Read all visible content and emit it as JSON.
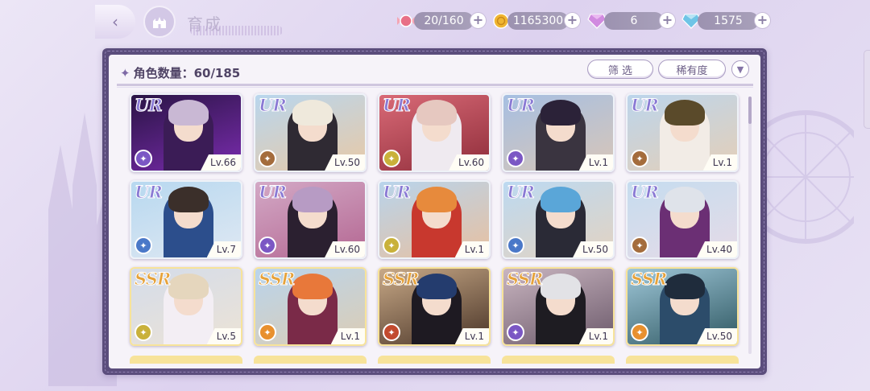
{
  "header": {
    "title": "育成",
    "resources": [
      {
        "name": "stamina",
        "icon": "candy-icon",
        "value": "20/160",
        "color": "#e86f86"
      },
      {
        "name": "gold",
        "icon": "coin-icon",
        "value": "1165300",
        "color": "#f0b532"
      },
      {
        "name": "pink-gem",
        "icon": "pink-diamond-icon",
        "value": "6",
        "color": "#d18ae0"
      },
      {
        "name": "blue-gem",
        "icon": "blue-diamond-icon",
        "value": "1575",
        "color": "#6ec4e6"
      }
    ]
  },
  "panel": {
    "count_label": "角色数量：60/185",
    "filter_label": "筛 选",
    "sort_label": "稀有度",
    "sort_toggle_icon": "chevron-down-icon"
  },
  "cards": [
    {
      "rarity": "UR",
      "level": "Lv.66",
      "element_color": "#7b57c4",
      "scene": [
        "#2a1445",
        "#7a2cae"
      ],
      "hair": "#c9b8d4",
      "outfit": "#3b1c56"
    },
    {
      "rarity": "UR",
      "level": "Lv.50",
      "element_color": "#a46c3c",
      "scene": [
        "#b9d6ee",
        "#e8c9a6"
      ],
      "hair": "#efe9dc",
      "outfit": "#2f2a33"
    },
    {
      "rarity": "UR",
      "level": "Lv.60",
      "element_color": "#c9b13a",
      "scene": [
        "#d96a77",
        "#8f2d3a"
      ],
      "hair": "#e6c8c0",
      "outfit": "#efeaf0"
    },
    {
      "rarity": "UR",
      "level": "Lv.1",
      "element_color": "#7b57c4",
      "scene": [
        "#a6bfe2",
        "#d8c6b8"
      ],
      "hair": "#2b2238",
      "outfit": "#3a3440"
    },
    {
      "rarity": "UR",
      "level": "Lv.1",
      "element_color": "#a46c3c",
      "scene": [
        "#bcd5ec",
        "#e4cfb8"
      ],
      "hair": "#5a4a2a",
      "outfit": "#f2ece6"
    },
    {
      "rarity": "UR",
      "level": "Lv.7",
      "element_color": "#4a78c8",
      "scene": [
        "#b7d8f0",
        "#dfe8f2"
      ],
      "hair": "#3b2f2a",
      "outfit": "#2c4e8c"
    },
    {
      "rarity": "UR",
      "level": "Lv.60",
      "element_color": "#7b57c4",
      "scene": [
        "#d3a9c6",
        "#b46792"
      ],
      "hair": "#b79bc4",
      "outfit": "#2b2030"
    },
    {
      "rarity": "UR",
      "level": "Lv.1",
      "element_color": "#c9b13a",
      "scene": [
        "#b8d4ec",
        "#e8c0a0"
      ],
      "hair": "#e78a3c",
      "outfit": "#c8382e"
    },
    {
      "rarity": "UR",
      "level": "Lv.50",
      "element_color": "#4a78c8",
      "scene": [
        "#bcd9f1",
        "#e3d3c2"
      ],
      "hair": "#5aa6d8",
      "outfit": "#2a2a36"
    },
    {
      "rarity": "UR",
      "level": "Lv.40",
      "element_color": "#a46c3c",
      "scene": [
        "#c5dcef",
        "#e6dbe7"
      ],
      "hair": "#dfe3ea",
      "outfit": "#6b2f74"
    },
    {
      "rarity": "SSR",
      "level": "Lv.5",
      "element_color": "#c9b13a",
      "scene": [
        "#d4dcea",
        "#ece3d6"
      ],
      "hair": "#e5d6bd",
      "outfit": "#f3eef4"
    },
    {
      "rarity": "SSR",
      "level": "Lv.1",
      "element_color": "#e8902e",
      "scene": [
        "#b9d4ec",
        "#dccdb5"
      ],
      "hair": "#e8783a",
      "outfit": "#7a2a48"
    },
    {
      "rarity": "SSR",
      "level": "Lv.1",
      "element_color": "#c24a2e",
      "scene": [
        "#c8a987",
        "#4a3528"
      ],
      "hair": "#243c6e",
      "outfit": "#1e1a22"
    },
    {
      "rarity": "SSR",
      "level": "Lv.1",
      "element_color": "#7b57c4",
      "scene": [
        "#c9b5c0",
        "#6c5a6b"
      ],
      "hair": "#e2e2e6",
      "outfit": "#1e1c22"
    },
    {
      "rarity": "SSR",
      "level": "Lv.50",
      "element_color": "#e8902e",
      "scene": [
        "#9fc7d8",
        "#2f5862"
      ],
      "hair": "#1f2c3c",
      "outfit": "#2c4c6a"
    }
  ]
}
